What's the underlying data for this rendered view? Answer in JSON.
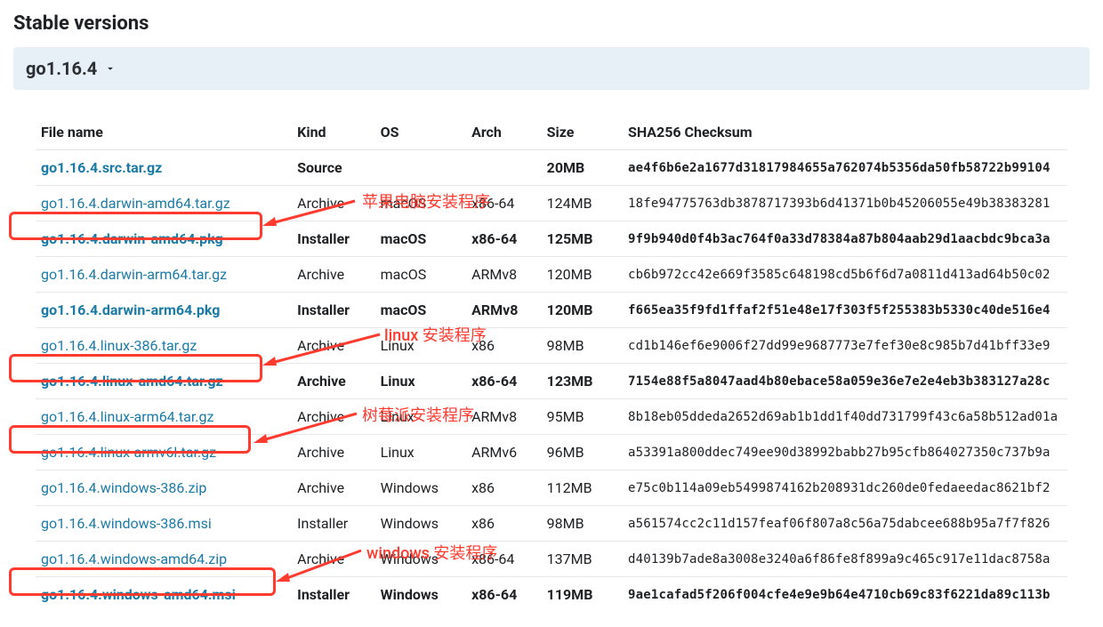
{
  "section_title": "Stable versions",
  "version_label": "go1.16.4",
  "headers": {
    "file": "File name",
    "kind": "Kind",
    "os": "OS",
    "arch": "Arch",
    "size": "Size",
    "sha": "SHA256 Checksum"
  },
  "rows": [
    {
      "file": "go1.16.4.src.tar.gz",
      "kind": "Source",
      "os": "",
      "arch": "",
      "size": "20MB",
      "sha": "ae4f6b6e2a1677d31817984655a762074b5356da50fb58722b99104",
      "cls": "source"
    },
    {
      "file": "go1.16.4.darwin-amd64.tar.gz",
      "kind": "Archive",
      "os": "macOS",
      "arch": "x86-64",
      "size": "124MB",
      "sha": "18fe94775763db3878717393b6d41371b0b45206055e49b38383281",
      "cls": ""
    },
    {
      "file": "go1.16.4.darwin-amd64.pkg",
      "kind": "Installer",
      "os": "macOS",
      "arch": "x86-64",
      "size": "125MB",
      "sha": "9f9b940d0f4b3ac764f0a33d78384a87b804aab29d1aacbdc9bca3a",
      "cls": "highlight"
    },
    {
      "file": "go1.16.4.darwin-arm64.tar.gz",
      "kind": "Archive",
      "os": "macOS",
      "arch": "ARMv8",
      "size": "120MB",
      "sha": "cb6b972cc42e669f3585c648198cd5b6f6d7a0811d413ad64b50c02",
      "cls": ""
    },
    {
      "file": "go1.16.4.darwin-arm64.pkg",
      "kind": "Installer",
      "os": "macOS",
      "arch": "ARMv8",
      "size": "120MB",
      "sha": "f665ea35f9fd1ffaf2f51e48e17f303f5f255383b5330c40de516e4",
      "cls": "highlight"
    },
    {
      "file": "go1.16.4.linux-386.tar.gz",
      "kind": "Archive",
      "os": "Linux",
      "arch": "x86",
      "size": "98MB",
      "sha": "cd1b146ef6e9006f27dd99e9687773e7fef30e8c985b7d41bff33e9",
      "cls": ""
    },
    {
      "file": "go1.16.4.linux-amd64.tar.gz",
      "kind": "Archive",
      "os": "Linux",
      "arch": "x86-64",
      "size": "123MB",
      "sha": "7154e88f5a8047aad4b80ebace58a059e36e7e2e4eb3b383127a28c",
      "cls": "highlight"
    },
    {
      "file": "go1.16.4.linux-arm64.tar.gz",
      "kind": "Archive",
      "os": "Linux",
      "arch": "ARMv8",
      "size": "95MB",
      "sha": "8b18eb05ddeda2652d69ab1b1dd1f40dd731799f43c6a58b512ad01a",
      "cls": ""
    },
    {
      "file": "go1.16.4.linux-armv6l.tar.gz",
      "kind": "Archive",
      "os": "Linux",
      "arch": "ARMv6",
      "size": "96MB",
      "sha": "a53391a800ddec749ee90d38992babb27b95cfb864027350c737b9a",
      "cls": ""
    },
    {
      "file": "go1.16.4.windows-386.zip",
      "kind": "Archive",
      "os": "Windows",
      "arch": "x86",
      "size": "112MB",
      "sha": "e75c0b114a09eb5499874162b208931dc260de0fedaeedac8621bf2",
      "cls": ""
    },
    {
      "file": "go1.16.4.windows-386.msi",
      "kind": "Installer",
      "os": "Windows",
      "arch": "x86",
      "size": "98MB",
      "sha": "a561574cc2c11d157feaf06f807a8c56a75dabcee688b95a7f7f826",
      "cls": ""
    },
    {
      "file": "go1.16.4.windows-amd64.zip",
      "kind": "Archive",
      "os": "Windows",
      "arch": "x86-64",
      "size": "137MB",
      "sha": "d40139b7ade8a3008e3240a6f86fe8f899a9c465c917e11dac8758a",
      "cls": ""
    },
    {
      "file": "go1.16.4.windows-amd64.msi",
      "kind": "Installer",
      "os": "Windows",
      "arch": "x86-64",
      "size": "119MB",
      "sha": "9ae1cafad5f206f004cfe4e9e9b64e4710cb69c83f6221da89c113b",
      "cls": "highlight"
    }
  ],
  "annotations": {
    "apple": "苹果电脑安装程序",
    "linux": "linux 安装程序",
    "rpi": "树莓派安装程序",
    "win": "windows 安装程序"
  }
}
